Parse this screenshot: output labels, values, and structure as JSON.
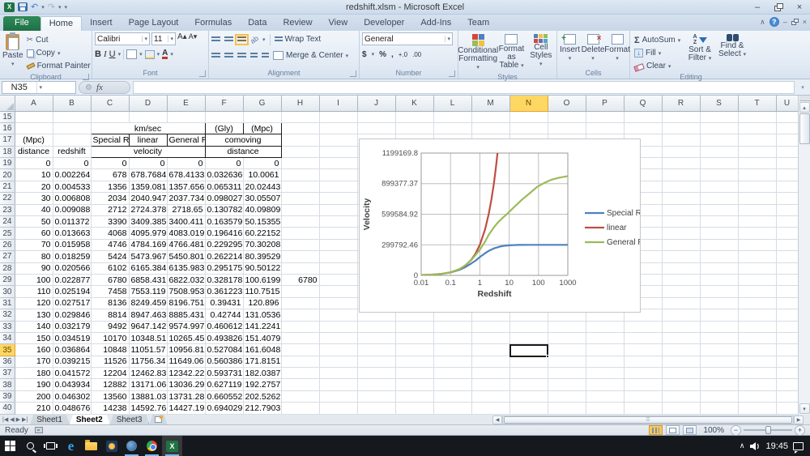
{
  "window": {
    "title": "redshift.xlsm - Microsoft Excel"
  },
  "ribbon": {
    "tabs": [
      {
        "label": "File",
        "type": "file"
      },
      {
        "label": "Home",
        "active": true
      },
      {
        "label": "Insert"
      },
      {
        "label": "Page Layout"
      },
      {
        "label": "Formulas"
      },
      {
        "label": "Data"
      },
      {
        "label": "Review"
      },
      {
        "label": "View"
      },
      {
        "label": "Developer"
      },
      {
        "label": "Add-Ins"
      },
      {
        "label": "Team"
      }
    ],
    "clipboard": {
      "label": "Clipboard",
      "paste": "Paste",
      "cut": "Cut",
      "copy": "Copy",
      "format_painter": "Format Painter"
    },
    "font": {
      "label": "Font",
      "family": "Calibri",
      "size": "11",
      "bold": "B",
      "italic": "I",
      "underline": "U"
    },
    "alignment": {
      "label": "Alignment",
      "wrap": "Wrap Text",
      "merge": "Merge & Center"
    },
    "number": {
      "label": "Number",
      "format": "General",
      "currency": "$",
      "percent": "%",
      "comma": ",",
      "inc_dec": "+.0",
      "dec_dec": ".00"
    },
    "styles": {
      "label": "Styles",
      "conditional_1": "Conditional",
      "conditional_2": "Formatting",
      "table_1": "Format",
      "table_2": "as Table",
      "cell_1": "Cell",
      "cell_2": "Styles"
    },
    "cells": {
      "label": "Cells",
      "insert": "Insert",
      "delete": "Delete",
      "format": "Format"
    },
    "editing": {
      "label": "Editing",
      "autosum": "AutoSum",
      "fill": "Fill",
      "clear": "Clear",
      "sort_1": "Sort &",
      "sort_2": "Filter",
      "find_1": "Find &",
      "find_2": "Select"
    }
  },
  "formula_bar": {
    "name_box": "N35",
    "fx": "fx",
    "value": ""
  },
  "grid": {
    "columns": [
      "A",
      "B",
      "C",
      "D",
      "E",
      "F",
      "G",
      "H",
      "I",
      "J",
      "K",
      "L",
      "M",
      "N",
      "O",
      "P",
      "Q",
      "R",
      "S",
      "T",
      "U"
    ],
    "selected_column": "N",
    "first_row": 15,
    "last_row": 40,
    "selected_row": 35,
    "header_cells": [
      {
        "r": 16,
        "c": "C",
        "span": 3,
        "v": "km/sec",
        "cls": "bd c"
      },
      {
        "r": 16,
        "c": "F",
        "v": "(Gly)",
        "cls": "bd c"
      },
      {
        "r": 16,
        "c": "G",
        "v": "(Mpc)",
        "cls": "bd c"
      },
      {
        "r": 17,
        "c": "A",
        "v": "(Mpc)",
        "cls": "c"
      },
      {
        "r": 17,
        "c": "C",
        "v": "Special R",
        "cls": "bd c"
      },
      {
        "r": 17,
        "c": "D",
        "v": "linear",
        "cls": "bd c"
      },
      {
        "r": 17,
        "c": "E",
        "v": "General R",
        "cls": "bd c"
      },
      {
        "r": 17,
        "c": "F",
        "span": 2,
        "v": "comoving",
        "cls": "bd c"
      },
      {
        "r": 18,
        "c": "A",
        "v": "distance",
        "cls": "c"
      },
      {
        "r": 18,
        "c": "B",
        "v": "redshift",
        "cls": "c"
      },
      {
        "r": 18,
        "c": "C",
        "span": 3,
        "v": "velocity",
        "cls": "bd c"
      },
      {
        "r": 18,
        "c": "F",
        "span": 2,
        "v": "distance",
        "cls": "bd c"
      }
    ],
    "data_start_row": 19,
    "data_columns": [
      "A",
      "B",
      "C",
      "D",
      "E",
      "F",
      "G"
    ],
    "data_rows": [
      [
        "0",
        "0",
        "0",
        "0",
        "0",
        "0",
        "0"
      ],
      [
        "10",
        "0.002264",
        "678",
        "678.7684",
        "678.4133",
        "0.032636",
        "10.0061"
      ],
      [
        "20",
        "0.004533",
        "1356",
        "1359.081",
        "1357.656",
        "0.065311",
        "20.02443"
      ],
      [
        "30",
        "0.006808",
        "2034",
        "2040.947",
        "2037.734",
        "0.098027",
        "30.05507"
      ],
      [
        "40",
        "0.009088",
        "2712",
        "2724.378",
        "2718.65",
        "0.130782",
        "40.09809"
      ],
      [
        "50",
        "0.011372",
        "3390",
        "3409.385",
        "3400.411",
        "0.163579",
        "50.15355"
      ],
      [
        "60",
        "0.013663",
        "4068",
        "4095.979",
        "4083.019",
        "0.196416",
        "60.22152"
      ],
      [
        "70",
        "0.015958",
        "4746",
        "4784.169",
        "4766.481",
        "0.229295",
        "70.30208"
      ],
      [
        "80",
        "0.018259",
        "5424",
        "5473.967",
        "5450.801",
        "0.262214",
        "80.39529"
      ],
      [
        "90",
        "0.020566",
        "6102",
        "6165.384",
        "6135.983",
        "0.295175",
        "90.50122"
      ],
      [
        "100",
        "0.022877",
        "6780",
        "6858.431",
        "6822.032",
        "0.328178",
        "100.6199"
      ],
      [
        "110",
        "0.025194",
        "7458",
        "7553.119",
        "7508.953",
        "0.361223",
        "110.7515"
      ],
      [
        "120",
        "0.027517",
        "8136",
        "8249.459",
        "8196.751",
        "0.39431",
        "120.896"
      ],
      [
        "130",
        "0.029846",
        "8814",
        "8947.463",
        "8885.431",
        "0.42744",
        "131.0536"
      ],
      [
        "140",
        "0.032179",
        "9492",
        "9647.142",
        "9574.997",
        "0.460612",
        "141.2241"
      ],
      [
        "150",
        "0.034519",
        "10170",
        "10348.51",
        "10265.45",
        "0.493826",
        "151.4079"
      ],
      [
        "160",
        "0.036864",
        "10848",
        "11051.57",
        "10956.81",
        "0.527084",
        "161.6048"
      ],
      [
        "170",
        "0.039215",
        "11526",
        "11756.34",
        "11649.06",
        "0.560386",
        "171.8151"
      ],
      [
        "180",
        "0.041572",
        "12204",
        "12462.83",
        "12342.22",
        "0.593731",
        "182.0387"
      ],
      [
        "190",
        "0.043934",
        "12882",
        "13171.06",
        "13036.29",
        "0.627119",
        "192.2757"
      ],
      [
        "200",
        "0.046302",
        "13560",
        "13881.03",
        "13731.28",
        "0.660552",
        "202.5262"
      ],
      [
        "210",
        "0.048676",
        "14238",
        "14592.76",
        "14427.19",
        "0.694029",
        "212.7903"
      ]
    ],
    "extra_cells": [
      {
        "r": 29,
        "c": "H",
        "v": "6780"
      }
    ]
  },
  "chart_data": {
    "type": "line",
    "xlabel": "Redshift",
    "ylabel": "Velocity",
    "x_scale": "log",
    "xlim": [
      0.01,
      1000
    ],
    "ylim": [
      0,
      1199169.8
    ],
    "x_ticks": [
      "0.01",
      "0.1",
      "1",
      "10",
      "100",
      "1000"
    ],
    "y_ticks": [
      "0",
      "299792.46",
      "599584.92",
      "899377.37",
      "1199169.8"
    ],
    "grid": true,
    "legend_position": "right",
    "series": [
      {
        "name": "Special R",
        "color": "#4f81bd",
        "points": [
          [
            0.01,
            2983
          ],
          [
            0.02,
            5937
          ],
          [
            0.05,
            14615
          ],
          [
            0.1,
            28488
          ],
          [
            0.2,
            54063
          ],
          [
            0.3,
            76900
          ],
          [
            0.5,
            115305
          ],
          [
            0.7,
            143000
          ],
          [
            1,
            179875
          ],
          [
            1.5,
            217084
          ],
          [
            2,
            239834
          ],
          [
            3,
            264523
          ],
          [
            5,
            283588
          ],
          [
            7,
            290568
          ],
          [
            10,
            294878
          ],
          [
            20,
            298436
          ],
          [
            50,
            299562
          ],
          [
            100,
            299733
          ],
          [
            1000,
            299792
          ]
        ]
      },
      {
        "name": "linear",
        "color": "#bf4e43",
        "points": [
          [
            0.01,
            2998
          ],
          [
            0.02,
            5996
          ],
          [
            0.05,
            14990
          ],
          [
            0.1,
            29979
          ],
          [
            0.2,
            59958
          ],
          [
            0.3,
            89938
          ],
          [
            0.5,
            149896
          ],
          [
            0.7,
            209855
          ],
          [
            1,
            299792
          ],
          [
            1.5,
            449689
          ],
          [
            2,
            599585
          ],
          [
            2.5,
            749481
          ],
          [
            3,
            899377
          ],
          [
            3.5,
            1049273
          ],
          [
            4,
            1199170
          ],
          [
            4.4,
            1320000
          ]
        ]
      },
      {
        "name": "General R",
        "color": "#9bbb59",
        "points": [
          [
            0.01,
            3000
          ],
          [
            0.02,
            6010
          ],
          [
            0.05,
            15100
          ],
          [
            0.1,
            30400
          ],
          [
            0.2,
            61500
          ],
          [
            0.3,
            93500
          ],
          [
            0.5,
            147000
          ],
          [
            0.7,
            196000
          ],
          [
            1,
            252000
          ],
          [
            1.5,
            330000
          ],
          [
            2,
            397000
          ],
          [
            3,
            470000
          ],
          [
            4,
            515000
          ],
          [
            6,
            565000
          ],
          [
            9,
            609000
          ],
          [
            15,
            672000
          ],
          [
            27,
            741000
          ],
          [
            50,
            805000
          ],
          [
            90,
            868000
          ],
          [
            160,
            908000
          ],
          [
            280,
            939000
          ],
          [
            500,
            958000
          ],
          [
            1000,
            974000
          ]
        ]
      }
    ]
  },
  "sheets": {
    "tabs": [
      {
        "label": "Sheet1"
      },
      {
        "label": "Sheet2",
        "active": true
      },
      {
        "label": "Sheet3"
      }
    ]
  },
  "status_bar": {
    "mode": "Ready",
    "zoom": "100%"
  },
  "taskbar": {
    "time": "19:45"
  }
}
